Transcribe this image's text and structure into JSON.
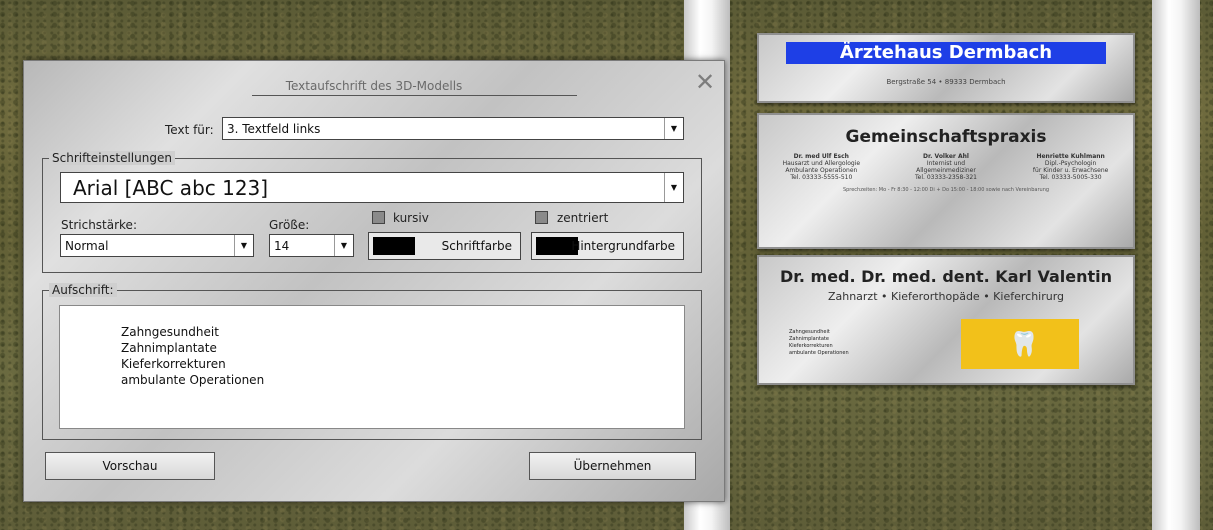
{
  "dialog": {
    "title": "Textaufschrift des 3D-Modells",
    "close": "✕",
    "text_for_label": "Text für:",
    "text_for_value": "3. Textfeld links",
    "font_group_label": "Schrifteinstellungen",
    "font_value": "Arial  [ABC abc 123]",
    "stroke_label": "Strichstärke:",
    "stroke_value": "Normal",
    "size_label": "Größe:",
    "size_value": "14",
    "italic_label": "kursiv",
    "centered_label": "zentriert",
    "font_color_label": "Schriftfarbe",
    "bg_color_label": "Hintergrundfarbe",
    "caption_group_label": "Aufschrift:",
    "caption_lines": [
      "Zahngesundheit",
      "Zahnimplantate",
      "Kieferkorrekturen",
      "ambulante Operationen"
    ],
    "preview_button": "Vorschau",
    "apply_button": "Übernehmen",
    "arrow": "▼"
  },
  "scene": {
    "sign1": {
      "title": "Ärztehaus Dermbach",
      "address": "Bergstraße 54  •  89333 Dermbach"
    },
    "sign2": {
      "title": "Gemeinschaftspraxis",
      "doctors": [
        {
          "name": "Dr. med Ulf Esch",
          "l1": "Hausarzt und Allergologie",
          "l2": "Ambulante Operationen",
          "l3": "Tel. 03333-5555-510"
        },
        {
          "name": "Dr. Volker Ahl",
          "l1": "Internist und",
          "l2": "Allgemeinmediziner",
          "l3": "Tel. 03333-2358-321"
        },
        {
          "name": "Henriette Kuhlmann",
          "l1": "Dipl.-Psychologin",
          "l2": "für Kinder u. Erwachsene",
          "l3": "Tel. 03333-5005-330"
        }
      ],
      "footer": "Sprechzeiten: Mo - Fr 8:30 - 12:00  Di + Do 15:00 - 18:00  sowie nach Vereinbarung"
    },
    "sign3": {
      "title": "Dr. med. Dr. med. dent. Karl Valentin",
      "subtitle": "Zahnarzt  •  Kieferorthopäde  •  Kieferchirurg",
      "lines": [
        "Zahngesundheit",
        "Zahnimplantate",
        "Kieferkorrekturen",
        "ambulante Operationen"
      ],
      "logo_color": "#f2c11a"
    }
  }
}
